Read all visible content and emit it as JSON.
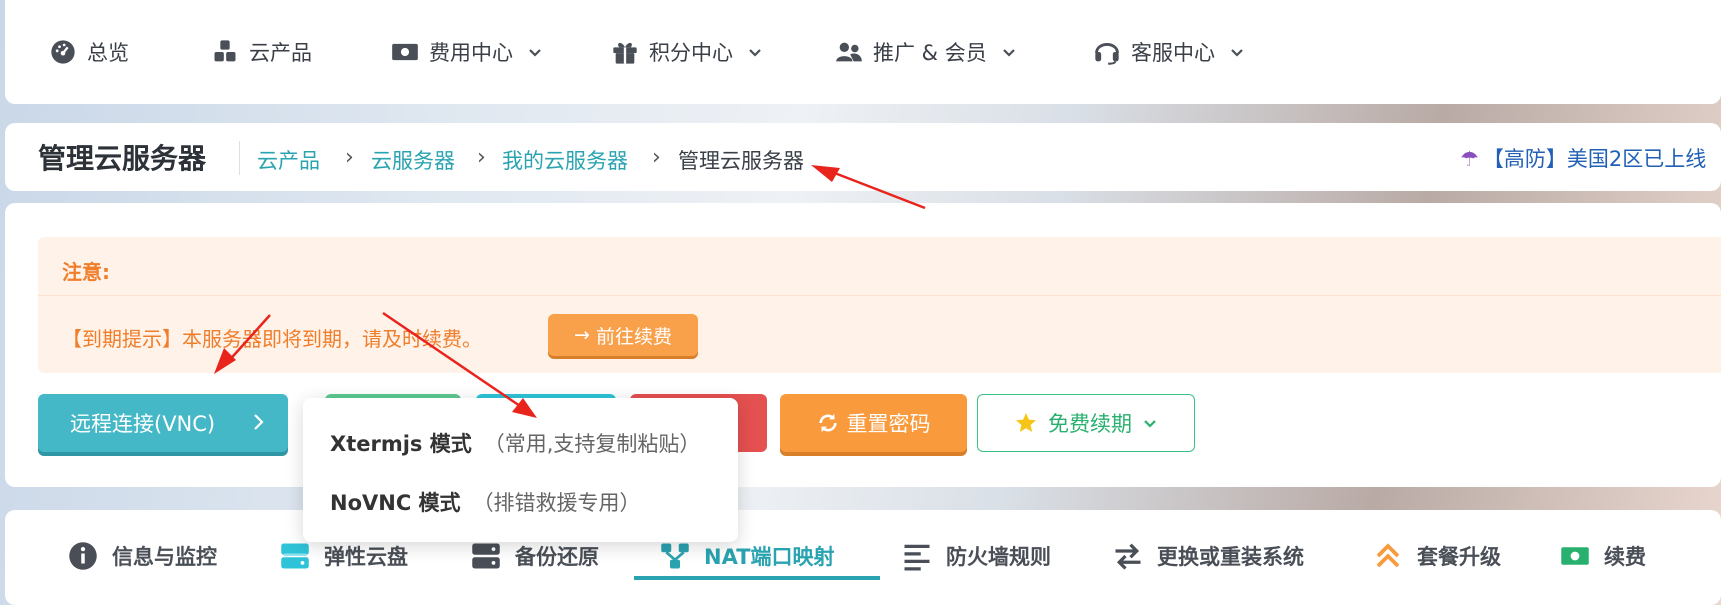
{
  "nav": {
    "items": [
      {
        "label": "总览"
      },
      {
        "label": "云产品"
      },
      {
        "label": "费用中心"
      },
      {
        "label": "积分中心"
      },
      {
        "label": "推广 & 会员"
      },
      {
        "label": "客服中心"
      }
    ]
  },
  "breadcrumb": {
    "title": "管理云服务器",
    "items": [
      "云产品",
      "云服务器",
      "我的云服务器",
      "管理云服务器"
    ],
    "separator": "›",
    "announcement": "【高防】美国2区已上线"
  },
  "notice": {
    "title": "注意:",
    "message": "【到期提示】本服务器即将到期，请及时续费。",
    "link_label": "前往续费"
  },
  "actions": {
    "vnc_label": "远程连接(VNC)",
    "reset_label": "重置密码",
    "free_label": "免费续期"
  },
  "dropdown": {
    "items": [
      {
        "name": "Xtermjs 模式",
        "hint": "（常用,支持复制粘贴）"
      },
      {
        "name": "NoVNC 模式",
        "hint": "（排错救援专用）"
      }
    ]
  },
  "tabs": {
    "items": [
      {
        "label": "信息与监控"
      },
      {
        "label": "弹性云盘"
      },
      {
        "label": "备份还原"
      },
      {
        "label": "NAT端口映射"
      },
      {
        "label": "防火墙规则"
      },
      {
        "label": "更换或重装系统"
      },
      {
        "label": "套餐升级"
      },
      {
        "label": "续费"
      }
    ],
    "active": "NAT端口映射"
  },
  "colors": {
    "accent": "#2aa3b0",
    "warning": "#f07d2a",
    "success": "#28b06e",
    "danger": "#e55050",
    "annotation": "#e8241d"
  }
}
